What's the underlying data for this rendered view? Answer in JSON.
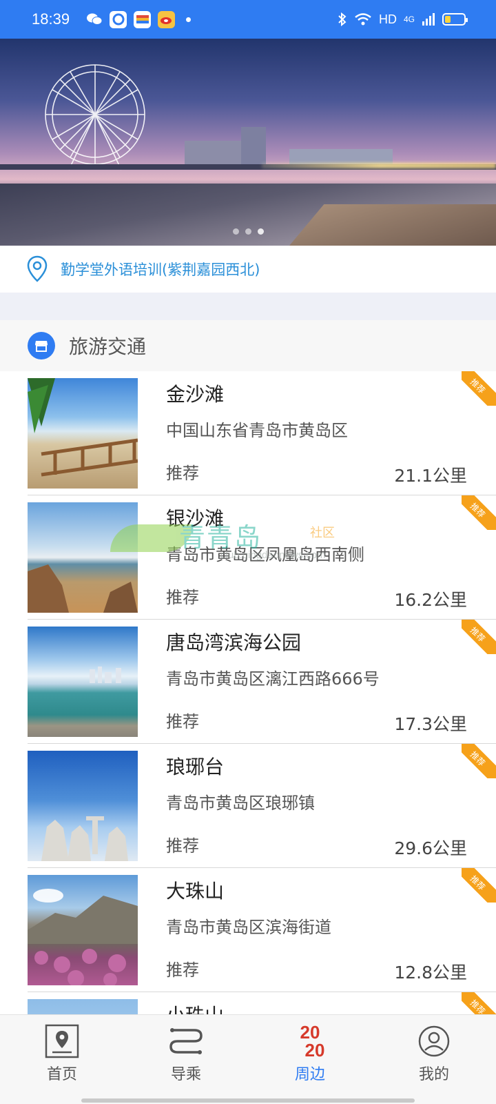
{
  "status_bar": {
    "time": "18:39",
    "right_text": "HD",
    "network": "4G",
    "icons": [
      "wechat-icon",
      "app-icon",
      "wallet-icon",
      "weibo-icon",
      "bluetooth-icon",
      "wifi-icon",
      "signal-icon",
      "battery-icon"
    ]
  },
  "banner": {
    "slide_count": 3,
    "active_slide": 2
  },
  "location": {
    "text": "勤学堂外语培训(紫荆嘉园西北)"
  },
  "section": {
    "title": "旅游交通",
    "accent": "#2f7cf2"
  },
  "items": [
    {
      "name": "金沙滩",
      "address": "中国山东省青岛市黄岛区",
      "tag": "推荐",
      "distance": "21.1公里",
      "badge": "推荐"
    },
    {
      "name": "银沙滩",
      "address": "青岛市黄岛区凤凰岛西南侧",
      "tag": "推荐",
      "distance": "16.2公里",
      "badge": "推荐"
    },
    {
      "name": "唐岛湾滨海公园",
      "address": "青岛市黄岛区漓江西路666号",
      "tag": "推荐",
      "distance": "17.3公里",
      "badge": "推荐"
    },
    {
      "name": "琅琊台",
      "address": "青岛市黄岛区琅琊镇",
      "tag": "推荐",
      "distance": "29.6公里",
      "badge": "推荐"
    },
    {
      "name": "大珠山",
      "address": "青岛市黄岛区滨海街道",
      "tag": "推荐",
      "distance": "12.8公里",
      "badge": "推荐"
    },
    {
      "name": "小珠山",
      "address": "",
      "tag": "",
      "distance": "",
      "badge": "推荐"
    }
  ],
  "watermark": {
    "brand": "青青岛",
    "sub": "社区",
    "url": "club.qingdaonews.com"
  },
  "nav": {
    "items": [
      {
        "label": "首页",
        "icon": "map-pin-icon"
      },
      {
        "label": "导乘",
        "icon": "route-icon"
      },
      {
        "label": "周边",
        "icon": "2020-icon",
        "badge_line1": "20",
        "badge_line2": "20"
      },
      {
        "label": "我的",
        "icon": "user-icon"
      }
    ],
    "active_index": 2
  },
  "colors": {
    "primary": "#2f7cf2",
    "badge": "#f6a11a",
    "link": "#2a8fd8"
  }
}
